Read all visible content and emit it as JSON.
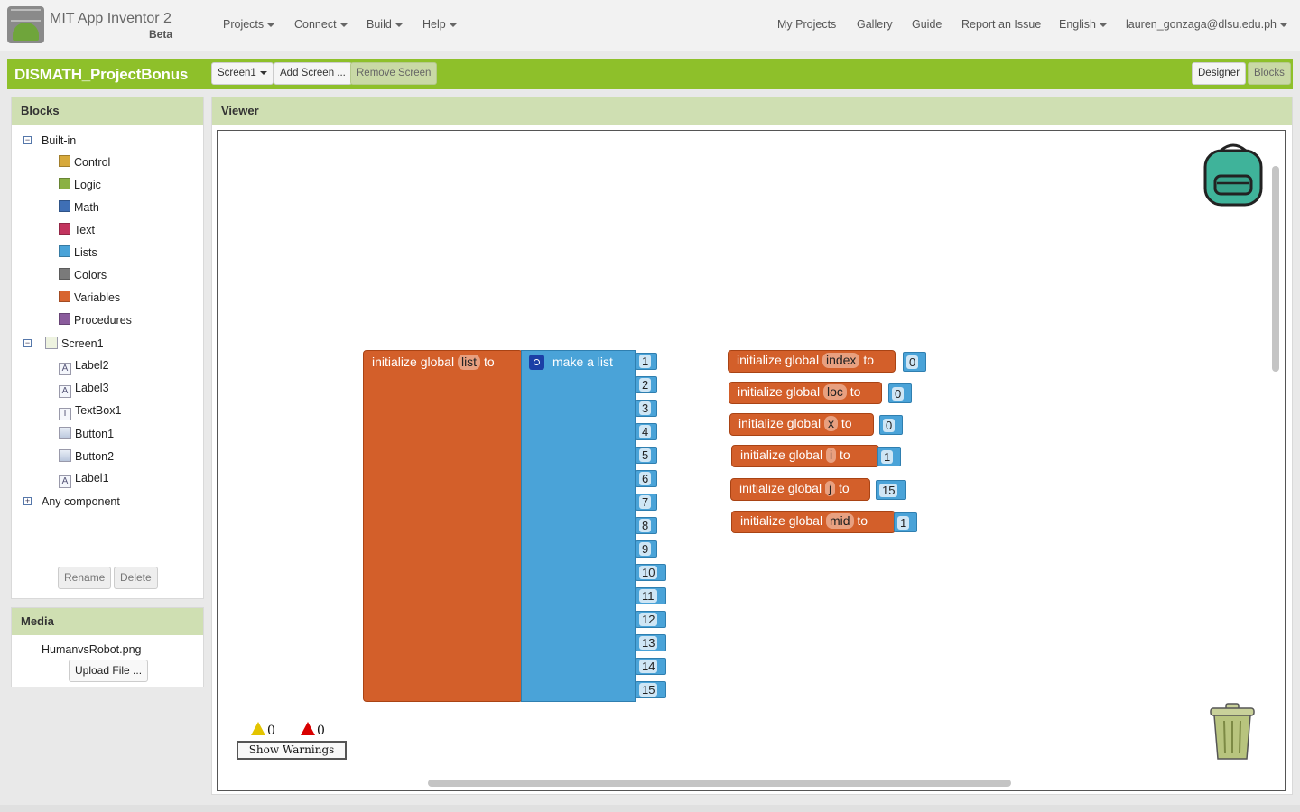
{
  "app": {
    "title": "MIT App Inventor 2",
    "beta": "Beta"
  },
  "nav": {
    "projects": "Projects",
    "connect": "Connect",
    "build": "Build",
    "help": "Help",
    "my_projects": "My Projects",
    "gallery": "Gallery",
    "guide": "Guide",
    "report": "Report an Issue",
    "language": "English",
    "user": "lauren_gonzaga@dlsu.edu.ph"
  },
  "project": {
    "name": "DISMATH_ProjectBonus",
    "screen_select": "Screen1",
    "add_screen": "Add Screen ...",
    "remove_screen": "Remove Screen",
    "designer": "Designer",
    "blocks": "Blocks"
  },
  "blocks_panel": {
    "title": "Blocks",
    "builtin": "Built-in",
    "categories": [
      {
        "label": "Control",
        "color": "#d7a93b"
      },
      {
        "label": "Logic",
        "color": "#8bb144"
      },
      {
        "label": "Math",
        "color": "#3f6fb5"
      },
      {
        "label": "Text",
        "color": "#c2345e"
      },
      {
        "label": "Lists",
        "color": "#4aa3d8"
      },
      {
        "label": "Colors",
        "color": "#7a7a7a"
      },
      {
        "label": "Variables",
        "color": "#d8652f"
      },
      {
        "label": "Procedures",
        "color": "#8a5b9c"
      }
    ],
    "screen": "Screen1",
    "components": [
      {
        "label": "Label2",
        "icon": "label-icon"
      },
      {
        "label": "Label3",
        "icon": "label-icon"
      },
      {
        "label": "TextBox1",
        "icon": "textbox-icon"
      },
      {
        "label": "Button1",
        "icon": "button-icon"
      },
      {
        "label": "Button2",
        "icon": "button-icon"
      },
      {
        "label": "Label1",
        "icon": "label-icon"
      }
    ],
    "any_component": "Any component",
    "rename": "Rename",
    "delete": "Delete"
  },
  "media_panel": {
    "title": "Media",
    "file": "HumanvsRobot.png",
    "upload": "Upload File ..."
  },
  "viewer": {
    "title": "Viewer",
    "list_block": {
      "prefix": "initialize global",
      "var": "list",
      "to": "to",
      "make_list": "make a list",
      "items": [
        "1",
        "2",
        "3",
        "4",
        "5",
        "6",
        "7",
        "8",
        "9",
        "10",
        "11",
        "12",
        "13",
        "14",
        "15"
      ]
    },
    "globals": [
      {
        "prefix": "initialize global",
        "var": "index",
        "to": "to",
        "value": "0"
      },
      {
        "prefix": "initialize global",
        "var": "loc",
        "to": "to",
        "value": "0"
      },
      {
        "prefix": "initialize global",
        "var": "x",
        "to": "to",
        "value": "0"
      },
      {
        "prefix": "initialize global",
        "var": "i",
        "to": "to",
        "value": "1"
      },
      {
        "prefix": "initialize global",
        "var": "j",
        "to": "to",
        "value": "15"
      },
      {
        "prefix": "initialize global",
        "var": "mid",
        "to": "to",
        "value": "1"
      }
    ],
    "warnings_count": "0",
    "errors_count": "0",
    "show_warnings": "Show Warnings"
  }
}
